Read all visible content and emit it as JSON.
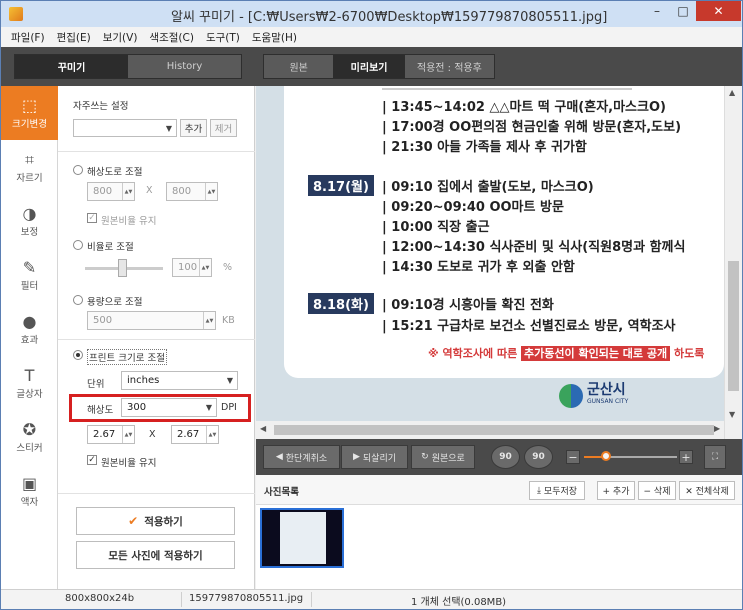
{
  "window": {
    "title": "알씨 꾸미기 - [C:₩Users₩2-6700₩Desktop₩159779870805511.jpg]",
    "min": "–",
    "max": "□",
    "close": "✕"
  },
  "menu": [
    "파일(F)",
    "편집(E)",
    "보기(V)",
    "색조절(C)",
    "도구(T)",
    "도움말(H)"
  ],
  "mode_tabs": [
    "꾸미기",
    "History"
  ],
  "view_tabs": [
    "원본",
    "미리보기",
    "적용전 : 적용후"
  ],
  "tools": [
    {
      "label": "크기변경",
      "icon": "⬚"
    },
    {
      "label": "자르기",
      "icon": "⌗"
    },
    {
      "label": "보정",
      "icon": "◑"
    },
    {
      "label": "필터",
      "icon": "✎"
    },
    {
      "label": "효과",
      "icon": "●"
    },
    {
      "label": "글상자",
      "icon": "T"
    },
    {
      "label": "스티커",
      "icon": "✪"
    },
    {
      "label": "액자",
      "icon": "▣"
    }
  ],
  "panel": {
    "favorites_label": "자주쓰는 설정",
    "add_label": "추가",
    "remove_label": "제거",
    "by_resolution": "해상도로 조절",
    "res_w": "800",
    "res_x": "X",
    "res_h": "800",
    "keep_ratio_1": "원본비율 유지",
    "by_ratio": "비율로 조절",
    "ratio_value": "100",
    "ratio_unit": "%",
    "by_size": "용량으로 조절",
    "size_value": "500",
    "size_unit": "KB",
    "by_print": "프린트 크기로 조절",
    "unit_label": "단위",
    "unit_value": "inches",
    "dpi_label": "해상도",
    "dpi_value": "300",
    "dpi_unit": "DPI",
    "print_w": "2.67",
    "print_x": "X",
    "print_h": "2.67",
    "keep_ratio_2": "원본비율 유지",
    "apply": "적용하기",
    "apply_all": "모든 사진에 적용하기"
  },
  "preview": {
    "lines_a": [
      "| 13:45~14:02 △△마트 떡 구매(혼자,마스크O)",
      "| 17:00경 OO편의점 현금인출 위해 방문(혼자,도보)",
      "| 21:30 아들 가족들 제사 후 귀가함"
    ],
    "date_817": "8.17(월)",
    "lines_b": [
      "| 09:10 집에서 출발(도보, 마스크O)",
      "| 09:20~09:40 OO마트 방문",
      "| 10:00 직장 출근",
      "| 12:00~14:30 식사준비 및 식사(직원8명과 함께식",
      "| 14:30 도보로 귀가 후 외출 안함"
    ],
    "date_818": "8.18(화)",
    "lines_c": [
      "| 09:10경 시흥아들 확진 전화",
      "| 15:21 구급차로 보건소 선별진료소 방문, 역학조사"
    ],
    "notice_a": "※ 역학조사에 따른",
    "notice_b": "추가동선이 확인되는 대로 공개",
    "notice_c": "하도록",
    "logo_name": "군산시",
    "logo_sub": "GUNSAN CITY"
  },
  "bottom": {
    "undo": "한단계취소",
    "redo": "되살리기",
    "original": "원본으로",
    "rot_l": "90",
    "rot_r": "90",
    "zoom_minus": "−",
    "zoom_plus": "+"
  },
  "photos": {
    "title": "사진목록",
    "save_all": "모두저장",
    "add": "+ 추가",
    "delete": "− 삭제",
    "delete_all": "✕ 전체삭제"
  },
  "status": {
    "dimensions": "800x800x24b",
    "filename": "159779870805511.jpg",
    "selection": "1 개체 선택(0.08MB)"
  }
}
